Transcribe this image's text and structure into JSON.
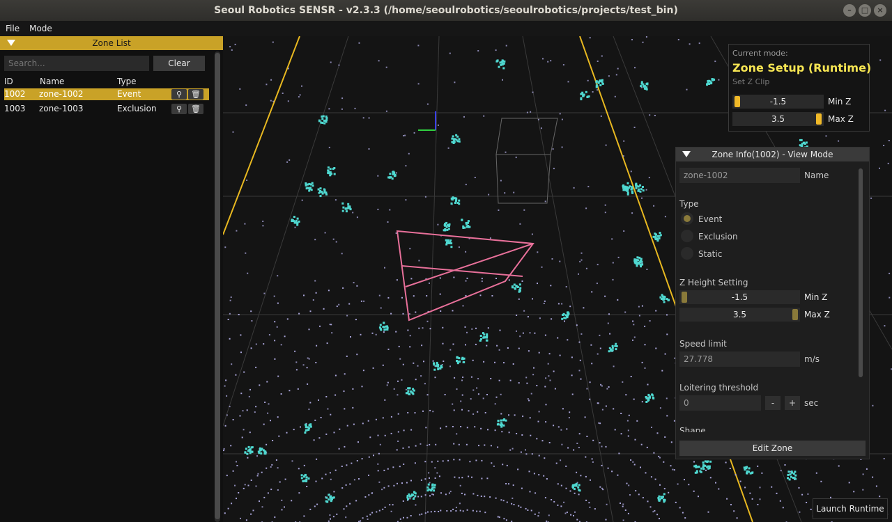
{
  "window": {
    "title": "Seoul Robotics SENSR - v2.3.3 (/home/seoulrobotics/seoulrobotics/projects/test_bin)"
  },
  "menu": {
    "file": "File",
    "mode": "Mode"
  },
  "zone_list": {
    "title": "Zone List",
    "search_placeholder": "Search...",
    "clear_label": "Clear",
    "columns": {
      "id": "ID",
      "name": "Name",
      "type": "Type"
    },
    "rows": [
      {
        "id": "1002",
        "name": "zone-1002",
        "type": "Event",
        "selected": true
      },
      {
        "id": "1003",
        "name": "zone-1003",
        "type": "Exclusion",
        "selected": false
      }
    ]
  },
  "mode_panel": {
    "current_mode_label": "Current mode:",
    "mode": "Zone Setup (Runtime)",
    "zclip_label": "Set Z Clip",
    "min_z": {
      "value": "-1.5",
      "label": "Min Z"
    },
    "max_z": {
      "value": "3.5",
      "label": "Max Z"
    }
  },
  "zone_info": {
    "title": "Zone Info(1002) - View Mode",
    "name_value": "zone-1002",
    "name_label": "Name",
    "type_label": "Type",
    "types": [
      "Event",
      "Exclusion",
      "Static"
    ],
    "selected_type": "Event",
    "z_height_label": "Z Height Setting",
    "min_z": {
      "value": "-1.5",
      "label": "Min Z"
    },
    "max_z": {
      "value": "3.5",
      "label": "Max Z"
    },
    "speed_label": "Speed limit",
    "speed_value": "27.778",
    "speed_unit": "m/s",
    "loiter_label": "Loitering threshold",
    "loiter_value": "0",
    "loiter_minus": "-",
    "loiter_plus": "+",
    "loiter_unit": "sec",
    "shape_label": "Shape",
    "edit_label": "Edit Zone"
  },
  "launch_label": "Launch Runtime",
  "colors": {
    "accent": "#c9a227",
    "knob": "#f0b928",
    "mode_text": "#f7e653",
    "zone_outline": "#e8709a",
    "points_a": "#a8a4d8",
    "points_b": "#4fd8d0",
    "boundary": "#e8b820"
  }
}
